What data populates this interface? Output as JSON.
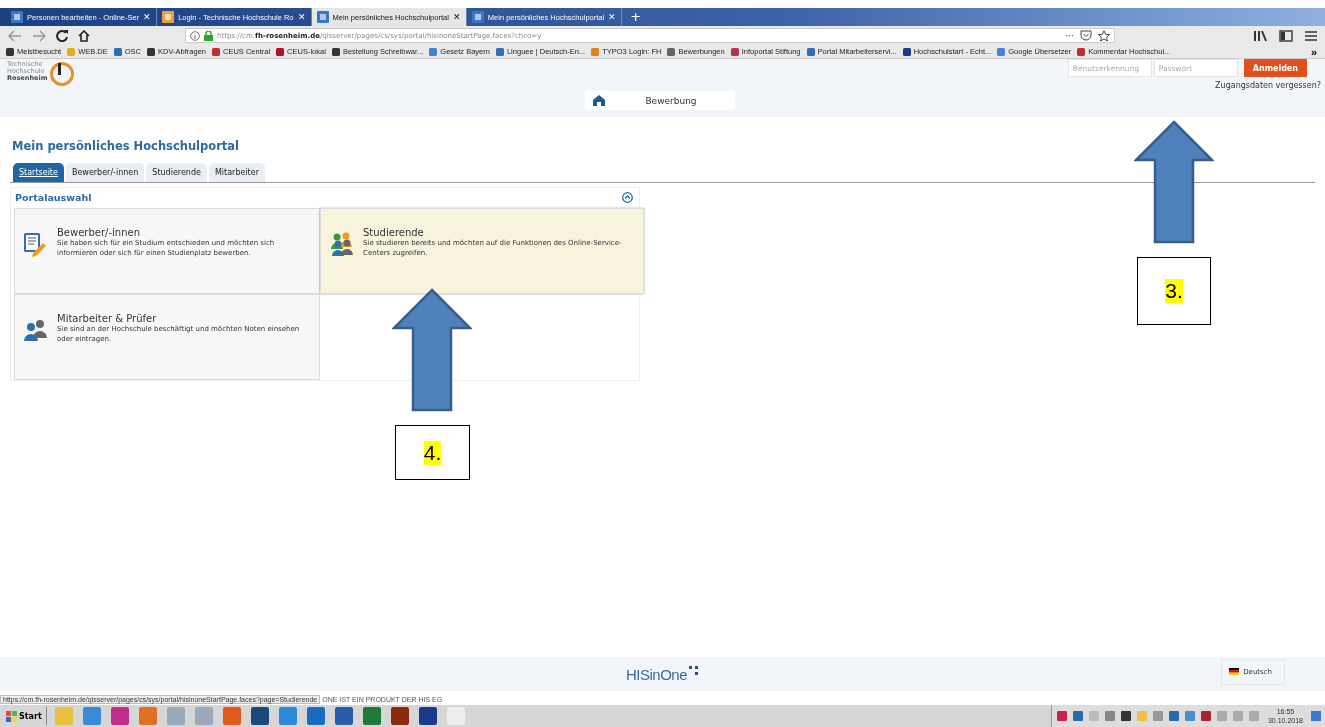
{
  "browser": {
    "tabs": [
      {
        "title": "Personen bearbeiten - Online-Ser",
        "selected": false
      },
      {
        "title": "Login - Technische Hochschule Ro",
        "selected": false
      },
      {
        "title": "Mein persönliches Hochschulportal",
        "selected": true
      },
      {
        "title": "Mein persönliches Hochschulportal",
        "selected": false
      }
    ],
    "tab_close": "✕",
    "new_tab": "+",
    "url": "https://cm.**fh-rosenheim.de**/qisserver/pages/cs/sys/portal/hisinoneStartPage.faces?chco=y",
    "url_more": "···",
    "bookmarks": [
      "Meistbesucht",
      "WEB.DE",
      "OSC",
      "KDV-Abfragen",
      "CEUS Central",
      "CEUS-lokal",
      "Bestellung Schreibwar...",
      "Gesetz Bayern",
      "Linguee | Deutsch-En...",
      "TYPO3 Login: FH",
      "Bewerbungen",
      "Infoportal Stiftung",
      "Portal Mitarbeiterservi...",
      "Hochschulstart - Echt...",
      "Google Übersetzer",
      "Kommentar Hochschul..."
    ],
    "bookmarks_more": "»"
  },
  "header": {
    "logo": [
      "Technische",
      "Hochschule",
      "Rosenheim"
    ],
    "login": {
      "username_placeholder": "Benutzerkennung",
      "password_placeholder": "Passwort",
      "button": "Anmelden",
      "forgot": "Zugangsdaten vergessen?"
    },
    "nav": [
      "Bewerbung"
    ]
  },
  "page": {
    "title": "Mein persönliches Hochschulportal",
    "tabs": [
      {
        "label": "Startseite",
        "selected": true
      },
      {
        "label": "Bewerber/-innen",
        "selected": false
      },
      {
        "label": "Studierende",
        "selected": false
      },
      {
        "label": "Mitarbeiter",
        "selected": false
      }
    ],
    "portal": {
      "title": "Portalauswahl",
      "tiles": [
        {
          "kind": "form",
          "title": "Bewerber/-innen",
          "text": "Sie haben sich für ein Studium entschieden und möchten sich informieren oder sich für einen Studienplatz bewerben.",
          "hovered": false
        },
        {
          "kind": "group",
          "title": "Studierende",
          "text": "Sie studieren bereits und möchten auf die Funktionen des Online-Service-Centers zugreifen.",
          "hovered": true
        },
        {
          "kind": "pair",
          "title": "Mitarbeiter & Prüfer",
          "text": "Sie sind an der Hochschule beschäftigt und möchten Noten einsehen oder eintragen.",
          "hovered": false
        }
      ]
    }
  },
  "footer": {
    "brand": "HISinOne",
    "language": "Deutsch"
  },
  "status_bar": {
    "url": "https://cm.fh-rosenheim.de/qisserver/pages/cs/sys/portal/hisinoneStartPage.faces?page=Studierende",
    "text": "ONE IST EIN PRODUKT DER HIS EG"
  },
  "taskbar": {
    "start": "Start",
    "time": "16:55",
    "date": "30.10.2018"
  },
  "annotations": [
    {
      "label": "3."
    },
    {
      "label": "4."
    }
  ]
}
